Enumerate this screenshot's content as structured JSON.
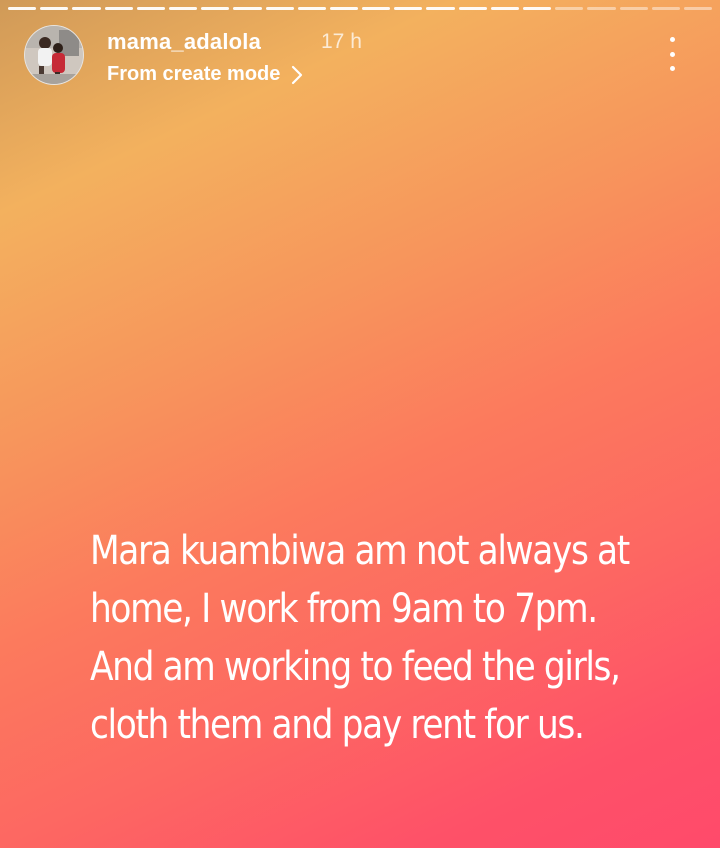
{
  "story": {
    "segments_total": 22,
    "segments_viewed": 17,
    "user": {
      "username": "mama_adalola",
      "time_ago": "17 h"
    },
    "subtitle": "From create mode",
    "text_lines": [
      "Mara kuambiwa am not always at",
      "home, I work from 9am to 7pm.",
      "And am working to feed the girls,",
      "cloth them and pay rent for us."
    ],
    "icons": {
      "more": "more-vertical-icon",
      "chevron": "chevron-right-icon"
    }
  }
}
